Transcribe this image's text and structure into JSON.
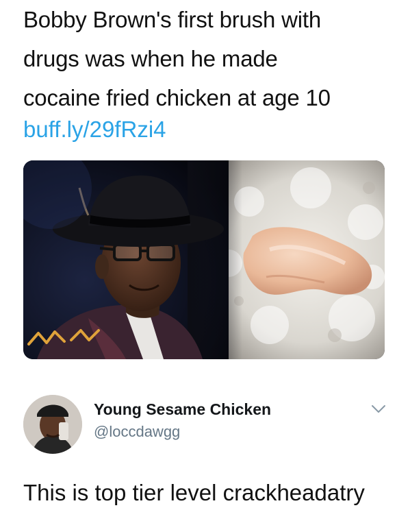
{
  "tweet": {
    "text_lines": [
      "Bobby Brown's first brush with",
      "drugs was when he made",
      "cocaine fried chicken at age 10"
    ],
    "link": "buff.ly/29fRzi4",
    "link_color": "#2aa3e6",
    "media": {
      "left_panel": "portrait of a man wearing a black fedora and glasses",
      "right_panel": "raw chicken piece in white flour"
    }
  },
  "reply": {
    "display_name": "Young Sesame Chicken",
    "handle": "@loccdawgg",
    "text": "This is top tier level crackheadatry",
    "menu_icon": "chevron-down-icon",
    "handle_color": "#657786"
  }
}
